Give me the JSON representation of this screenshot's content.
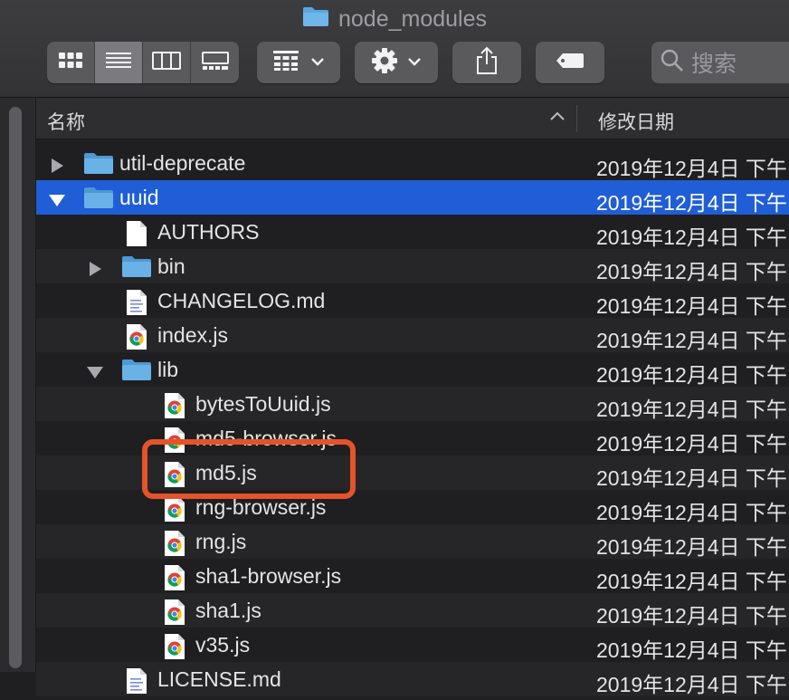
{
  "window": {
    "title": "node_modules"
  },
  "toolbar": {
    "search_placeholder": "搜索"
  },
  "columns": {
    "name": "名称",
    "date_modified": "修改日期"
  },
  "rows": [
    {
      "name": "util-deprecate",
      "date": "2019年12月4日 下午",
      "kind": "folder",
      "level": 0,
      "expanded": false,
      "selected": false
    },
    {
      "name": "uuid",
      "date": "2019年12月4日 下午",
      "kind": "folder",
      "level": 0,
      "expanded": true,
      "selected": true
    },
    {
      "name": "AUTHORS",
      "date": "2019年12月4日 下午",
      "kind": "document",
      "level": 1,
      "selected": false
    },
    {
      "name": "bin",
      "date": "2019年12月4日 下午",
      "kind": "folder",
      "level": 1,
      "expanded": false,
      "selected": false
    },
    {
      "name": "CHANGELOG.md",
      "date": "2019年12月4日 下午",
      "kind": "text",
      "level": 1,
      "selected": false
    },
    {
      "name": "index.js",
      "date": "2019年12月4日 下午",
      "kind": "js",
      "level": 1,
      "selected": false
    },
    {
      "name": "lib",
      "date": "2019年12月4日 下午",
      "kind": "folder",
      "level": 1,
      "expanded": true,
      "selected": false
    },
    {
      "name": "bytesToUuid.js",
      "date": "2019年12月4日 下午",
      "kind": "js",
      "level": 2,
      "selected": false
    },
    {
      "name": "md5-browser.js",
      "date": "2019年12月4日 下午",
      "kind": "js",
      "level": 2,
      "selected": false
    },
    {
      "name": "md5.js",
      "date": "2019年12月4日 下午",
      "kind": "js",
      "level": 2,
      "selected": false
    },
    {
      "name": "rng-browser.js",
      "date": "2019年12月4日 下午",
      "kind": "js",
      "level": 2,
      "selected": false
    },
    {
      "name": "rng.js",
      "date": "2019年12月4日 下午",
      "kind": "js",
      "level": 2,
      "selected": false
    },
    {
      "name": "sha1-browser.js",
      "date": "2019年12月4日 下午",
      "kind": "js",
      "level": 2,
      "selected": false
    },
    {
      "name": "sha1.js",
      "date": "2019年12月4日 下午",
      "kind": "js",
      "level": 2,
      "selected": false
    },
    {
      "name": "v35.js",
      "date": "2019年12月4日 下午",
      "kind": "js",
      "level": 2,
      "selected": false
    },
    {
      "name": "LICENSE.md",
      "date": "2019年12月4日 下午",
      "kind": "text",
      "level": 1,
      "selected": false
    }
  ],
  "colors": {
    "selection": "#1f5ed6",
    "folder": "#5aa6e0",
    "annotation": "#e4532a"
  }
}
